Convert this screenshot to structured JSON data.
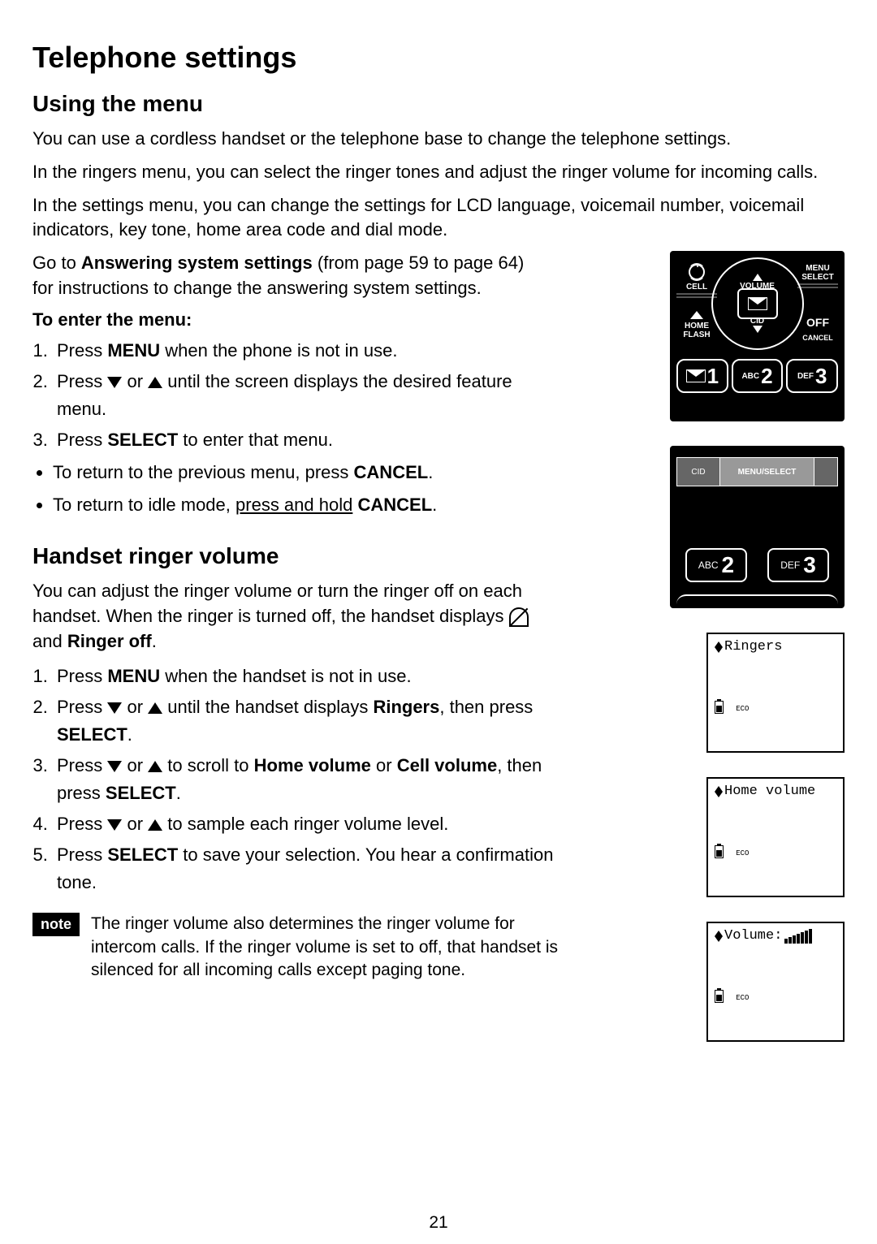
{
  "page_number": "21",
  "title": "Telephone settings",
  "section1": {
    "heading": "Using the menu",
    "p1": "You can use a cordless handset or the telephone base to change the telephone settings.",
    "p2": "In the ringers menu, you can select the ringer tones and adjust the ringer volume for incoming calls.",
    "p3": "In the settings menu, you can change the settings for LCD language, voicemail number, voicemail indicators, key tone, home area code and dial mode.",
    "p4a": "Go to ",
    "p4b": "Answering system settings",
    "p4c": " (from page 59 to page 64) for instructions to change the answering system settings."
  },
  "enter_menu": {
    "heading": "To enter the menu:",
    "s1a": "Press ",
    "s1b": "MENU",
    "s1c": " when the phone is not in use.",
    "s2a": "Press ",
    "s2b": " or ",
    "s2c": " until the screen displays the desired feature menu.",
    "s3a": "Press ",
    "s3b": "SELECT",
    "s3c": " to enter that menu.",
    "b1a": "To return to the previous menu, press ",
    "b1b": "CANCEL",
    "b1c": ".",
    "b2a": "To return to idle mode, ",
    "b2b": "press and hold",
    "b2c": " ",
    "b2d": "CANCEL",
    "b2e": "."
  },
  "ringer": {
    "heading": "Handset ringer volume",
    "p1a": "You can adjust the ringer volume or turn the ringer off on each handset. When the ringer is turned off, the handset displays ",
    "p1b": " and ",
    "p1c": "Ringer off",
    "p1d": ".",
    "s1a": "Press ",
    "s1b": "MENU",
    "s1c": " when the handset is not in use.",
    "s2a": "Press ",
    "s2b": " or ",
    "s2c": " until the handset displays ",
    "s2d": "Ringers",
    "s2e": ", then press ",
    "s2f": "SELECT",
    "s2g": ".",
    "s3a": "Press ",
    "s3b": " or ",
    "s3c": " to scroll to ",
    "s3d": "Home volume",
    "s3e": " or ",
    "s3f": "Cell volume",
    "s3g": ", then press ",
    "s3h": "SELECT",
    "s3i": ".",
    "s4a": "Press ",
    "s4b": " or ",
    "s4c": " to sample each ringer volume level.",
    "s5a": "Press ",
    "s5b": "SELECT",
    "s5c": " to save your selection. You hear a confirmation tone."
  },
  "note": {
    "label": "note",
    "text": "The ringer volume also determines the ringer volume for intercom calls. If the ringer volume is set to off, that handset is silenced for all incoming calls except paging tone."
  },
  "handset_keypad": {
    "cell": "CELL",
    "menu": "MENU",
    "select": "SELECT",
    "home": "HOME",
    "flash": "FLASH",
    "off": "OFF",
    "cancel": "CANCEL",
    "volume": "VOLUME",
    "cid": "CID",
    "key1_sub": "",
    "key1_num": "1",
    "key2_sub": "ABC",
    "key2_num": "2",
    "key3_sub": "DEF",
    "key3_num": "3"
  },
  "base_keypad": {
    "cid": "CID",
    "menu_select": "MENU/SELECT",
    "key2_sub": "ABC",
    "key2_num": "2",
    "key3_sub": "DEF",
    "key3_num": "3"
  },
  "lcd1": {
    "line": "Ringers",
    "eco": "ECO"
  },
  "lcd2": {
    "line": "Home volume",
    "eco": "ECO"
  },
  "lcd3": {
    "line": "Volume:",
    "eco": "ECO"
  }
}
